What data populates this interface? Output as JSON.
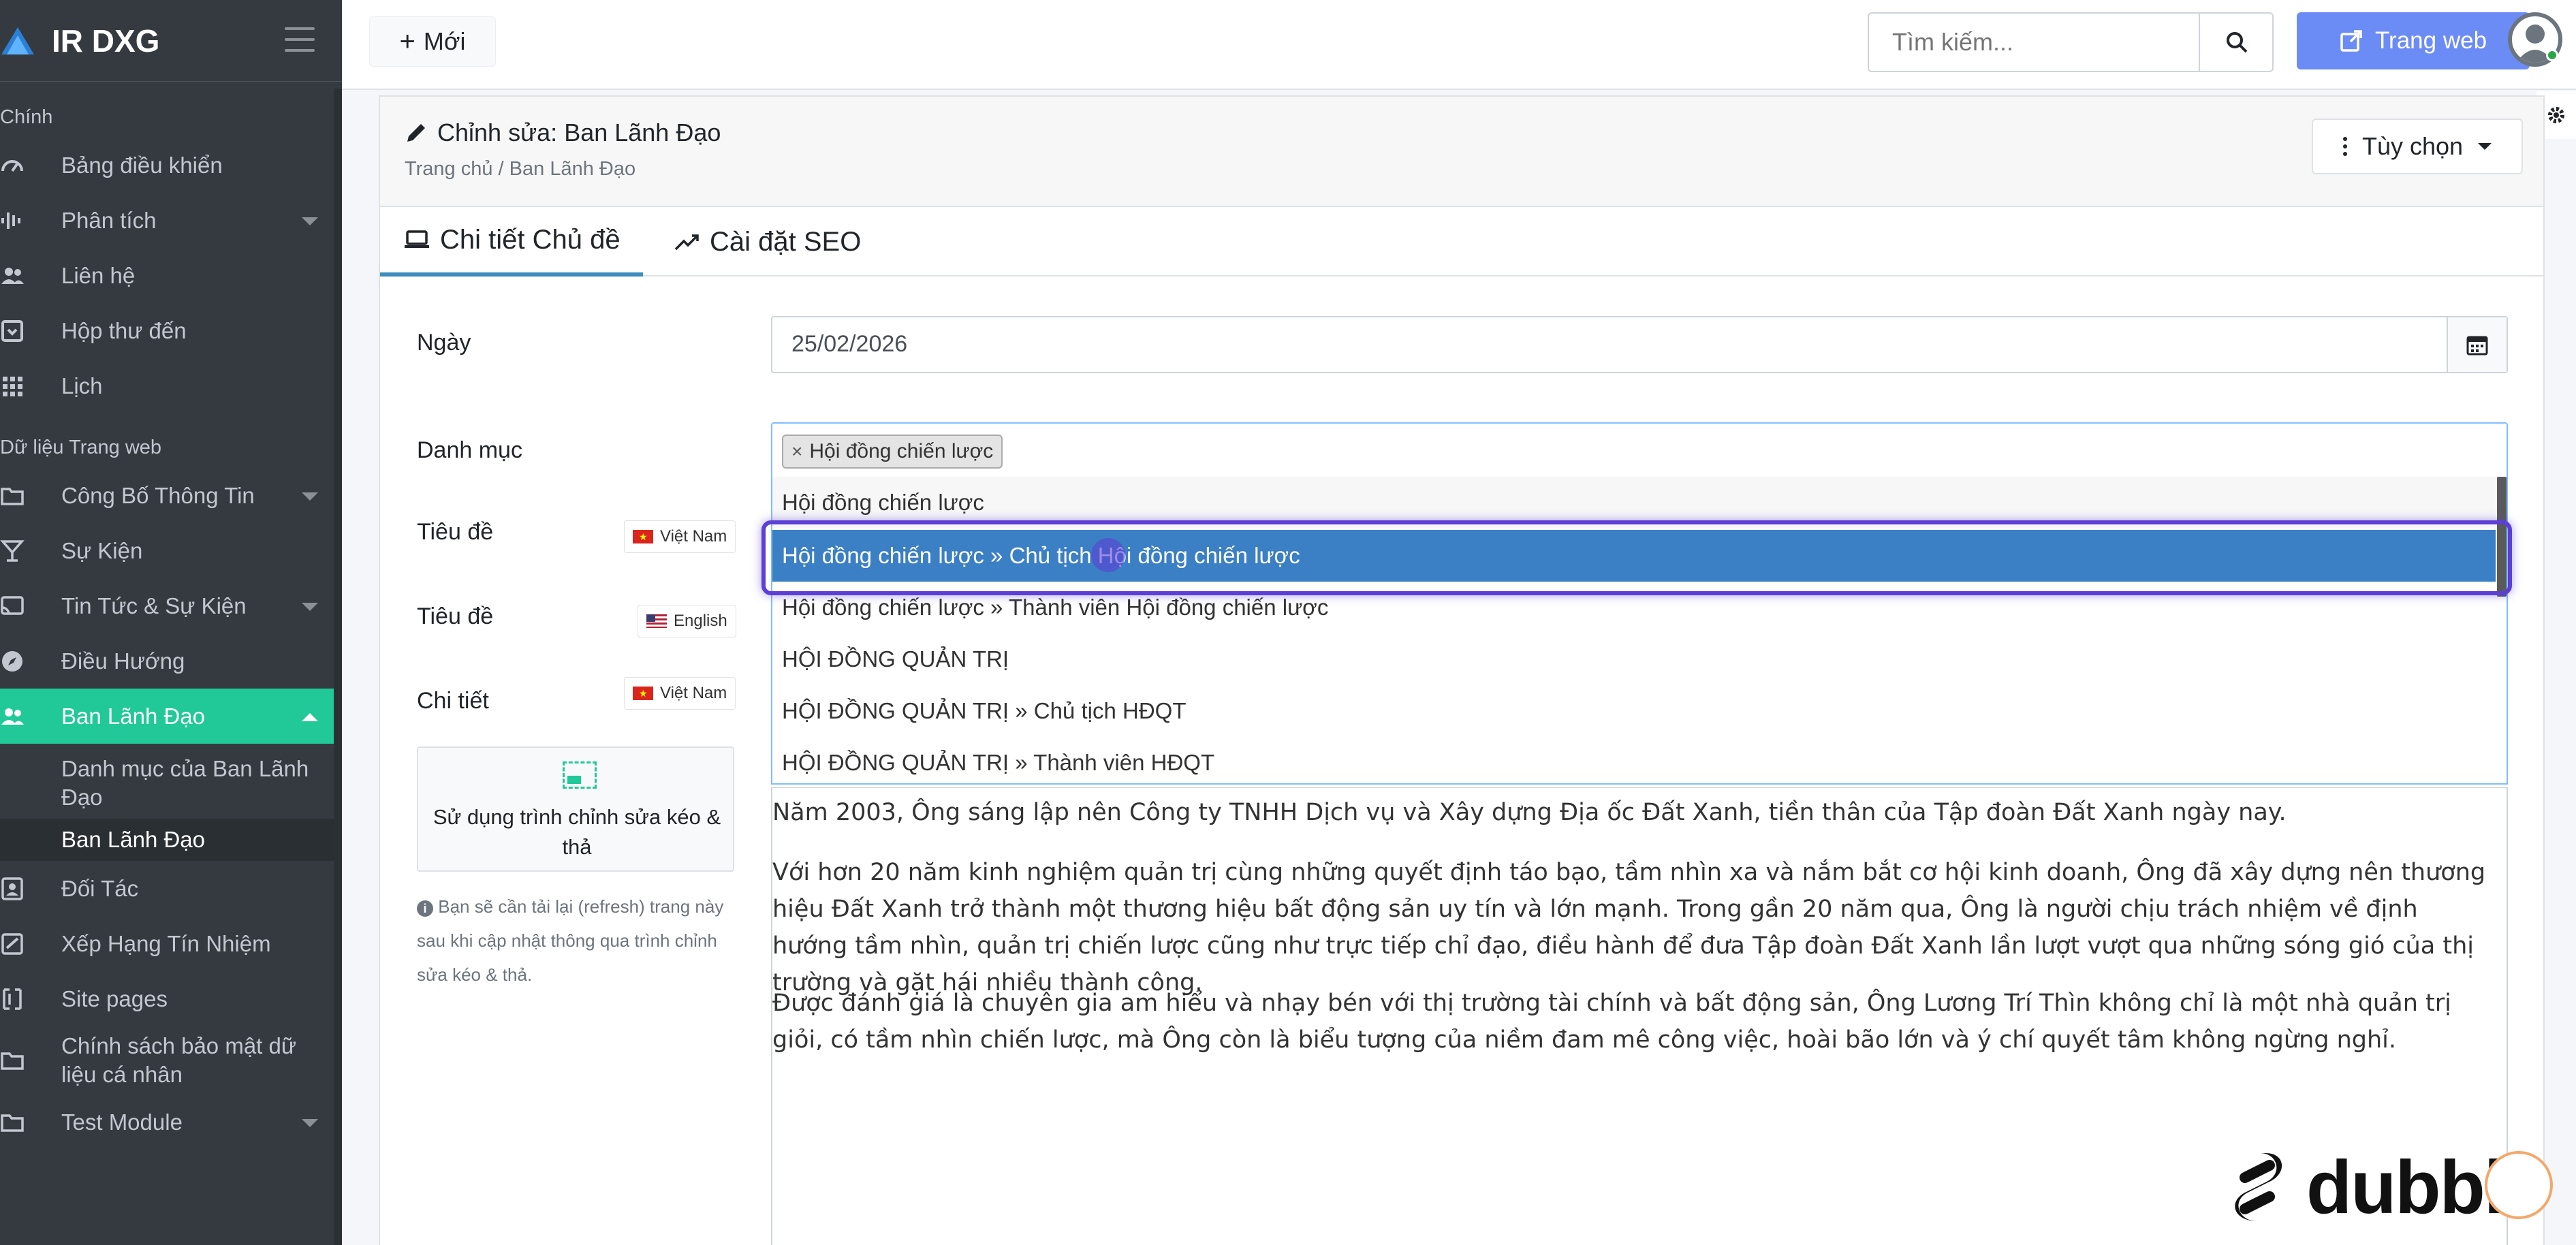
{
  "brand": {
    "name": "IR DXG"
  },
  "sidebar": {
    "section_main": "Chính",
    "main_items": [
      {
        "label": "Bảng điều khiển",
        "icon": "dashboard-icon"
      },
      {
        "label": "Phân tích",
        "icon": "analytics-icon"
      },
      {
        "label": "Liên hệ",
        "icon": "users-icon"
      },
      {
        "label": "Hộp thư đến",
        "icon": "inbox-icon"
      },
      {
        "label": "Lịch",
        "icon": "grid-icon"
      }
    ],
    "section_web": "Dữ liệu Trang web",
    "web_items": [
      {
        "label": "Công Bố Thông Tin",
        "icon": "folder-icon"
      },
      {
        "label": "Sự Kiện",
        "icon": "glass-icon"
      },
      {
        "label": "Tin Tức & Sự Kiện",
        "icon": "cast-icon"
      },
      {
        "label": "Điều Hướng",
        "icon": "compass-icon"
      },
      {
        "label": "Ban Lãnh Đạo",
        "icon": "users-icon"
      }
    ],
    "sub_items": [
      {
        "label": "Danh mục của Ban Lãnh Đạo"
      },
      {
        "label": "Ban Lãnh Đạo"
      }
    ],
    "bottom_items": [
      {
        "label": "Đối Tác",
        "icon": "contact-icon"
      },
      {
        "label": "Xếp Hạng Tín Nhiệm",
        "icon": "rating-icon"
      },
      {
        "label": "Site pages",
        "icon": "pages-icon"
      },
      {
        "label": "Chính sách bảo mật dữ liệu cá nhân",
        "icon": "folder-icon"
      },
      {
        "label": "Test Module",
        "icon": "folder-icon"
      }
    ],
    "active_color": "#20c997"
  },
  "topbar": {
    "new_label": "Mới",
    "search_placeholder": "Tìm kiếm...",
    "web_label": "Trang web"
  },
  "page": {
    "title": "Chỉnh sửa: Ban Lãnh Đạo",
    "breadcrumb": "Trang chủ / Ban Lãnh Đạo",
    "options_label": "Tùy chọn"
  },
  "tabs": [
    {
      "label": "Chi tiết Chủ đề"
    },
    {
      "label": "Cài đặt SEO"
    }
  ],
  "form": {
    "date_label": "Ngày",
    "date_value": "25/02/2026",
    "category_label": "Danh mục",
    "selected_tag": "Hội đồng chiến lược",
    "title_label": "Tiêu đề",
    "title_label_en": "Tiêu đề",
    "detail_label": "Chi tiết",
    "lang_vn": "Việt Nam",
    "lang_en": "English",
    "lang_vn_detail": "Việt Nam",
    "dnd_text": "Sử dụng trình chỉnh sửa kéo & thả",
    "help_text": "Bạn sẽ cần tải lại (refresh) trang này sau khi cập nhật thông qua trình chỉnh sửa kéo & thả."
  },
  "dropdown_options": [
    {
      "label": "Hội đồng chiến lược"
    },
    {
      "label": "Hội đồng chiến lược » Chủ tịch Hội đồng chiến lược"
    },
    {
      "label": "Hội đồng chiến lược » Thành viên Hội đồng chiến lược"
    },
    {
      "label": "HỘI ĐỒNG QUẢN TRỊ"
    },
    {
      "label": "HỘI ĐỒNG QUẢN TRỊ » Chủ tịch HĐQT"
    },
    {
      "label": "HỘI ĐỒNG QUẢN TRỊ » Thành viên HĐQT"
    }
  ],
  "editor": {
    "paragraphs": [
      "Năm 2003, Ông sáng lập nên Công ty TNHH Dịch vụ và Xây dựng Địa ốc Đất Xanh, tiền thân của Tập đoàn Đất Xanh ngày nay.",
      "Với hơn 20 năm kinh nghiệm quản trị cùng những quyết định táo bạo, tầm nhìn xa và nắm bắt cơ hội kinh doanh, Ông đã xây dựng nên thương hiệu Đất Xanh trở thành một thương hiệu bất động sản uy tín và lớn mạnh. Trong gần 20 năm qua, Ông là người chịu trách nhiệm về định hướng tầm nhìn, quản trị chiến lược cũng như trực tiếp chỉ đạo, điều hành để đưa Tập đoàn Đất Xanh lần lượt vượt qua những sóng gió của thị trường và gặt hái nhiều thành công.",
      "Được đánh giá là chuyên gia am hiểu và nhạy bén với thị trường tài chính và bất động sản, Ông Lương Trí Thìn không chỉ là một nhà quản trị giỏi, có tầm nhìn chiến lược, mà Ông còn là biểu tượng của niềm đam mê công việc, hoài bão lớn và ý chí quyết tâm không ngừng nghỉ."
    ]
  },
  "watermark": {
    "text": "dubble"
  }
}
